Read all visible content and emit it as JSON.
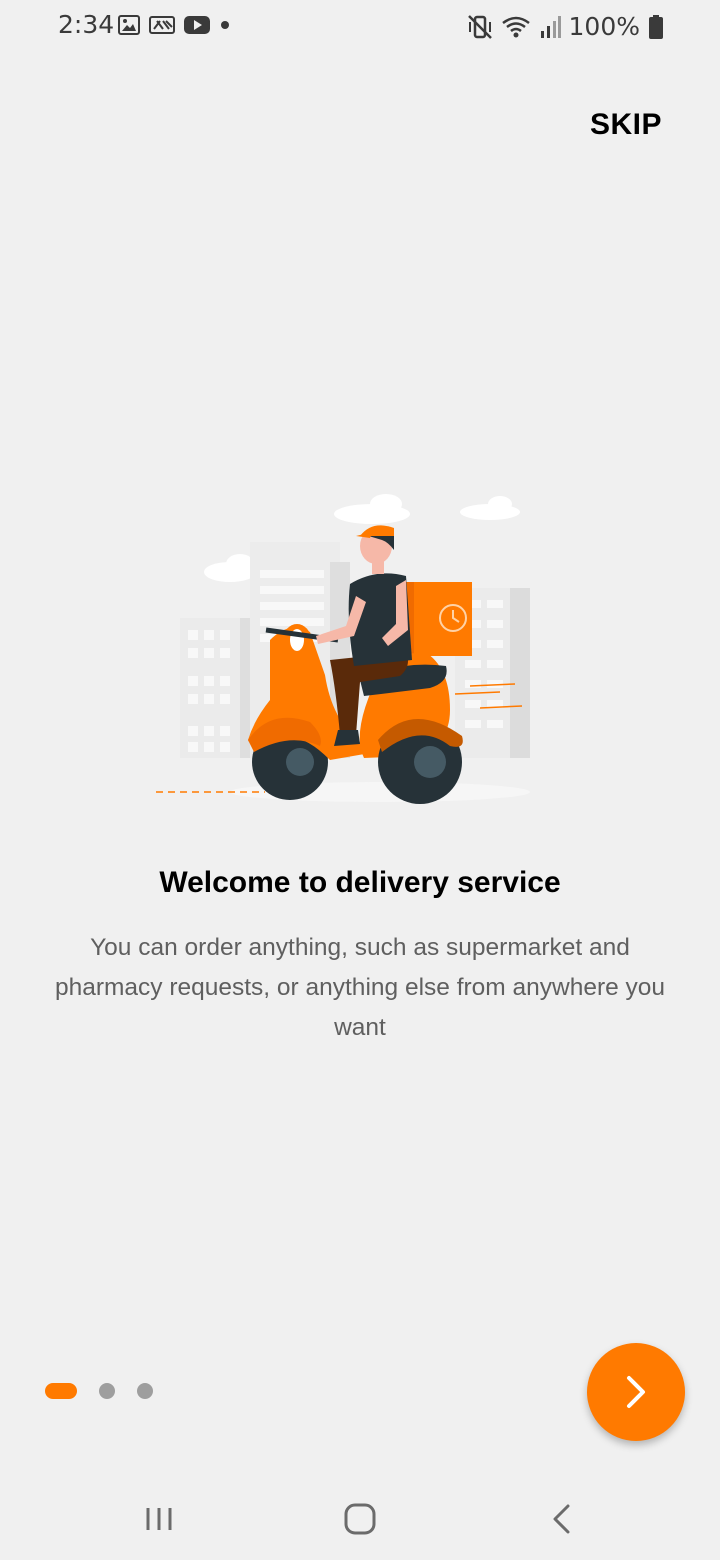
{
  "status_bar": {
    "time": "2:34",
    "left_icons": [
      "image-icon",
      "cast-icon",
      "youtube-icon",
      "dot-icon"
    ],
    "right_icons": [
      "mute-vibrate-icon",
      "wifi-icon",
      "signal-icon",
      "battery-icon"
    ],
    "battery": "100%"
  },
  "header": {
    "skip_label": "SKIP"
  },
  "onboarding": {
    "illustration": "delivery-scooter-illustration",
    "title": "Welcome to delivery service",
    "description": "You can order anything, such as supermarket and pharmacy requests, or anything else from anywhere you want",
    "page_count": 3,
    "current_page": 1
  },
  "next_button": {
    "icon": "chevron-right-icon"
  },
  "nav_bar": {
    "items": [
      "recents-icon",
      "home-icon",
      "back-icon"
    ]
  },
  "colors": {
    "accent": "#ff7a00",
    "background": "#f0f0f0",
    "text_secondary": "#5f5f5f",
    "dot_inactive": "#9e9e9e"
  }
}
